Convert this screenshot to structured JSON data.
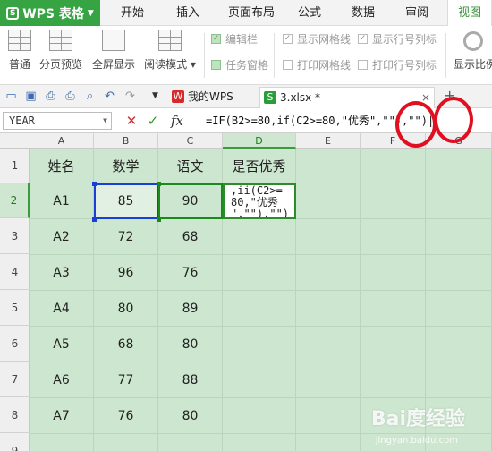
{
  "app": {
    "title": "WPS 表格",
    "logo_letter": "S"
  },
  "menu": {
    "tabs": [
      "开始",
      "插入",
      "页面布局",
      "公式",
      "数据",
      "审阅",
      "视图"
    ],
    "active": "视图"
  },
  "ribbon": {
    "normal": "普通",
    "page_break": "分页预览",
    "fullscreen": "全屏显示",
    "reading_mode": "阅读模式 ▾",
    "edit_bar": "编辑栏",
    "task_pane": "任务窗格",
    "show_gridlines": "显示网格线",
    "print_gridlines": "打印网格线",
    "show_headers": "显示行号列标",
    "print_headers": "打印行号列标",
    "display_ratio": "显示比例"
  },
  "doc_tabs": [
    {
      "label": "我的WPS",
      "icon": "wps-icon"
    },
    {
      "label": "3.xlsx *",
      "icon": "spreadsheet-icon"
    }
  ],
  "formula_bar": {
    "name_box": "YEAR",
    "cancel_icon": "✕",
    "confirm_icon": "✓",
    "fx_label": "fx",
    "formula": "=IF(B2>=80,if(C2>=80,\"优秀\",\"\"),\"\")|"
  },
  "columns": [
    "A",
    "B",
    "C",
    "D",
    "E",
    "F",
    "G"
  ],
  "selected_column": "D",
  "selected_row": "2",
  "rows": [
    "1",
    "2",
    "3",
    "4",
    "5",
    "6",
    "7",
    "8",
    "9"
  ],
  "table": {
    "headers": [
      "姓名",
      "数学",
      "语文",
      "是否优秀"
    ],
    "data": [
      [
        "A1",
        "85",
        "90",
        ""
      ],
      [
        "A2",
        "72",
        "68",
        ""
      ],
      [
        "A3",
        "96",
        "76",
        ""
      ],
      [
        "A4",
        "80",
        "89",
        ""
      ],
      [
        "A5",
        "68",
        "80",
        ""
      ],
      [
        "A6",
        "77",
        "88",
        ""
      ],
      [
        "A7",
        "76",
        "80",
        ""
      ]
    ],
    "active_cell_text": ",ii(C2>=\n80,\"优秀\n\",\"\"),\"\")"
  },
  "watermark": {
    "text": "Bai度经验",
    "sub": "jingyan.baidu.com"
  },
  "colors": {
    "accent": "#36a442",
    "sheet_bg": "#cde6cf",
    "annotation": "#e01020",
    "ref_b": "#1a3fd6"
  }
}
